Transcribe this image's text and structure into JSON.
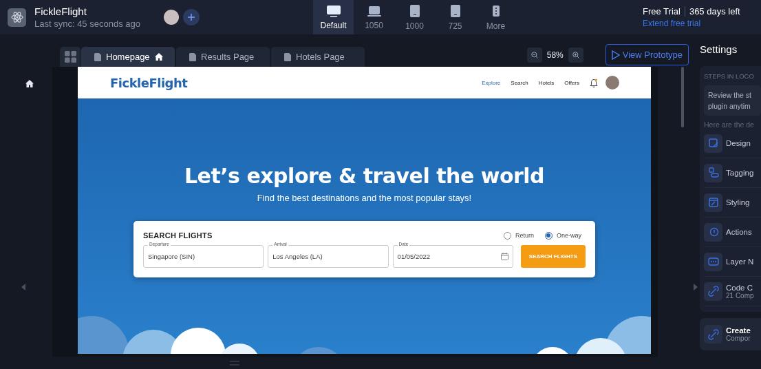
{
  "app": {
    "title": "FickleFlight",
    "sync": "Last sync: 45 seconds ago"
  },
  "devices": [
    {
      "label": "Default",
      "kind": "desktop",
      "selected": true
    },
    {
      "label": "1050",
      "kind": "laptop",
      "selected": false
    },
    {
      "label": "1000",
      "kind": "tablet",
      "selected": false
    },
    {
      "label": "725",
      "kind": "tablet",
      "selected": false
    },
    {
      "label": "More",
      "kind": "more",
      "selected": false
    }
  ],
  "trial": {
    "plan": "Free Trial",
    "remaining": "365 days left",
    "link": "Extend free trial"
  },
  "tabs": [
    {
      "label": "Homepage",
      "home": true,
      "selected": true
    },
    {
      "label": "Results Page",
      "home": false,
      "selected": false
    },
    {
      "label": "Hotels Page",
      "home": false,
      "selected": false
    }
  ],
  "zoom": "58%",
  "prototype_button": "View Prototype",
  "preview": {
    "logo": "FickleFlight",
    "nav": [
      {
        "label": "Explore",
        "selected": true
      },
      {
        "label": "Search",
        "selected": false
      },
      {
        "label": "Hotels",
        "selected": false
      },
      {
        "label": "Offers",
        "selected": false
      }
    ],
    "headline": "Let’s explore & travel the world",
    "subhead": "Find the best destinations and the most popular stays!",
    "search": {
      "title": "SEARCH FLIGHTS",
      "trip_types": [
        {
          "label": "Return",
          "selected": false
        },
        {
          "label": "One-way",
          "selected": true
        }
      ],
      "fields": [
        {
          "label": "Departure",
          "value": "Singapore (SIN)",
          "kind": "text"
        },
        {
          "label": "Arrival",
          "value": "Los Angeles (LA)",
          "kind": "text"
        },
        {
          "label": "Date",
          "value": "01/05/2022",
          "kind": "date"
        }
      ],
      "button": "SEARCH FLIGHTS"
    }
  },
  "settings": {
    "title": "Settings",
    "section": "STEPS IN LOCO",
    "note": [
      "Review the st",
      "plugin anytim"
    ],
    "intro": "Here are the de",
    "steps": [
      {
        "title": "Design",
        "kind": "design"
      },
      {
        "title": "Tagging",
        "kind": "tag"
      },
      {
        "title": "Styling",
        "kind": "style"
      },
      {
        "title": "Actions",
        "kind": "action"
      },
      {
        "title": "Layer N",
        "kind": "layer"
      },
      {
        "title": "Code C",
        "sub": "21 Comp",
        "kind": "link"
      }
    ],
    "create": {
      "title": "Create",
      "sub": "Compor"
    }
  }
}
